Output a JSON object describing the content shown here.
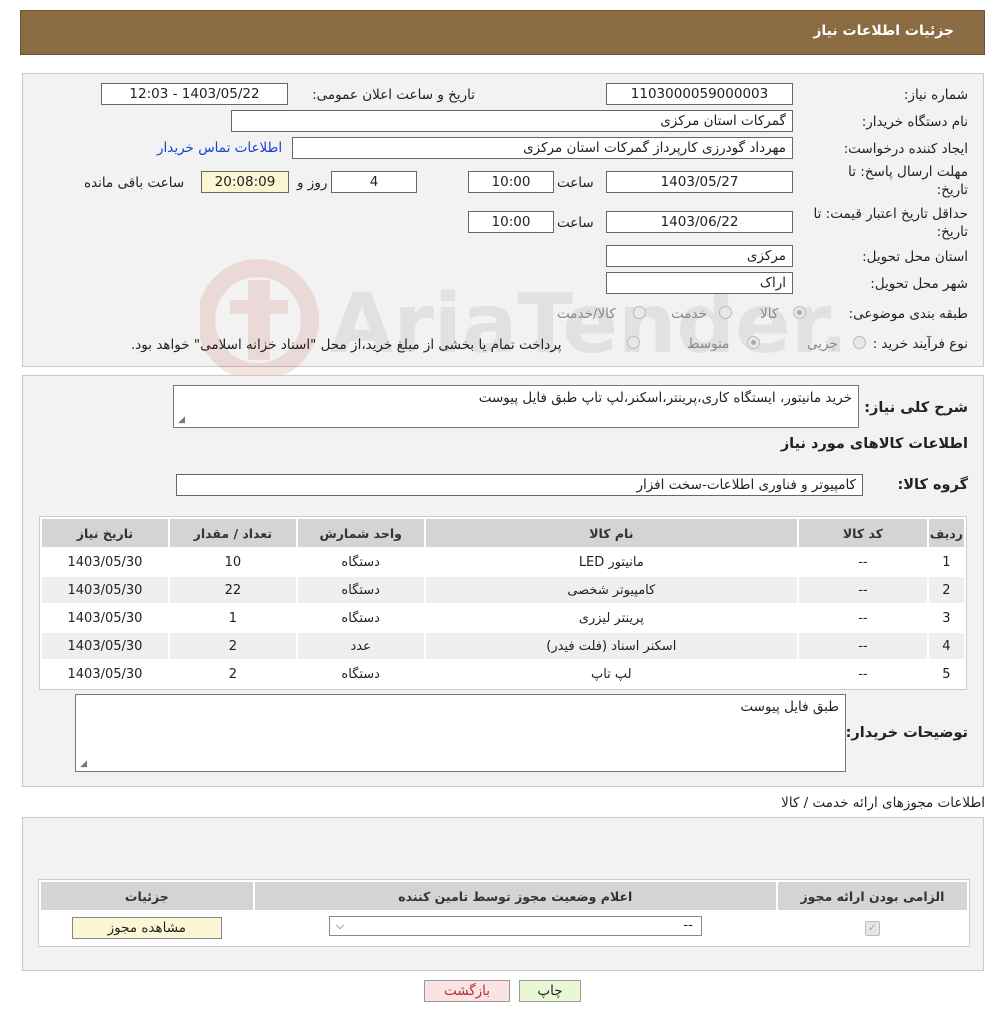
{
  "header": {
    "title": "جزئیات اطلاعات نیاز"
  },
  "form": {
    "need_number_label": "شماره نیاز:",
    "need_number": "1103000059000003",
    "announce_label": "تاریخ و ساعت اعلان عمومی:",
    "announce_value": "1403/05/22 - 12:03",
    "buyer_org_label": "نام دستگاه خریدار:",
    "buyer_org": "گمرکات استان مرکزی",
    "creator_label": "ایجاد کننده درخواست:",
    "creator": "مهرداد گودرزی کارپرداز گمرکات استان مرکزی",
    "contact_link": "اطلاعات تماس خریدار",
    "deadline_label_1": "مهلت ارسال پاسخ: تا",
    "deadline_label_2": "تاریخ:",
    "deadline_date": "1403/05/27",
    "time_label": "ساعت",
    "deadline_time": "10:00",
    "days_value": "4",
    "days_label": "روز و",
    "remaining_time": "20:08:09",
    "remaining_label": "ساعت باقی مانده",
    "validity_label_1": "حداقل تاریخ اعتبار قیمت: تا",
    "validity_label_2": "تاریخ:",
    "validity_date": "1403/06/22",
    "validity_time": "10:00",
    "province_label": "استان محل تحویل:",
    "province": "مرکزی",
    "city_label": "شهر محل تحویل:",
    "city": "اراک",
    "category_label": "طبقه بندی موضوعی:",
    "category_options": [
      "کالا",
      "خدمت",
      "کالا/خدمت"
    ],
    "category_selected": "کالا",
    "process_label": "نوع فرآیند خرید :",
    "process_options": [
      "جزیی",
      "متوسط"
    ],
    "process_note": "پرداخت تمام یا بخشی از مبلغ خرید،از محل \"اسناد خزانه اسلامی\" خواهد بود."
  },
  "details": {
    "summary_label": "شرح کلی نیاز:",
    "summary": "خرید مانیتور، ایستگاه کاری،پرینتر،اسکنر،لپ تاپ طبق فایل پیوست",
    "goods_info_title": "اطلاعات کالاهای مورد نیاز",
    "group_label": "گروه کالا:",
    "group": "کامپیوتر و فناوری اطلاعات-سخت افزار",
    "table": {
      "headers": [
        "ردیف",
        "کد کالا",
        "نام کالا",
        "واحد شمارش",
        "تعداد / مقدار",
        "تاریخ نیاز"
      ],
      "rows": [
        [
          "1",
          "--",
          "مانیتور LED",
          "دستگاه",
          "10",
          "1403/05/30"
        ],
        [
          "2",
          "--",
          "کامپیوتر شخصی",
          "دستگاه",
          "22",
          "1403/05/30"
        ],
        [
          "3",
          "--",
          "پرینتر لیزری",
          "دستگاه",
          "1",
          "1403/05/30"
        ],
        [
          "4",
          "--",
          "اسکنر اسناد (فلت فیدر)",
          "عدد",
          "2",
          "1403/05/30"
        ],
        [
          "5",
          "--",
          "لپ تاپ",
          "دستگاه",
          "2",
          "1403/05/30"
        ]
      ]
    },
    "buyer_notes_label": "توضیحات خریدار:",
    "buyer_notes": "طبق فایل پیوست"
  },
  "permits": {
    "title": "اطلاعات مجوزهای ارائه خدمت / کالا",
    "headers": [
      "الزامی بودن ارائه مجوز",
      "اعلام وضعیت مجوز توسط تامین کننده",
      "جزئیات"
    ],
    "select_value": "--",
    "view_button": "مشاهده مجوز"
  },
  "buttons": {
    "print": "چاپ",
    "back": "بازگشت"
  },
  "watermark": {
    "text": "AriaTender.neT"
  },
  "colors": {
    "header_bg": "#8b6c42",
    "link": "#1a3fd6",
    "print_bg": "#eaf7d6",
    "back_bg": "#fbe3e3"
  }
}
